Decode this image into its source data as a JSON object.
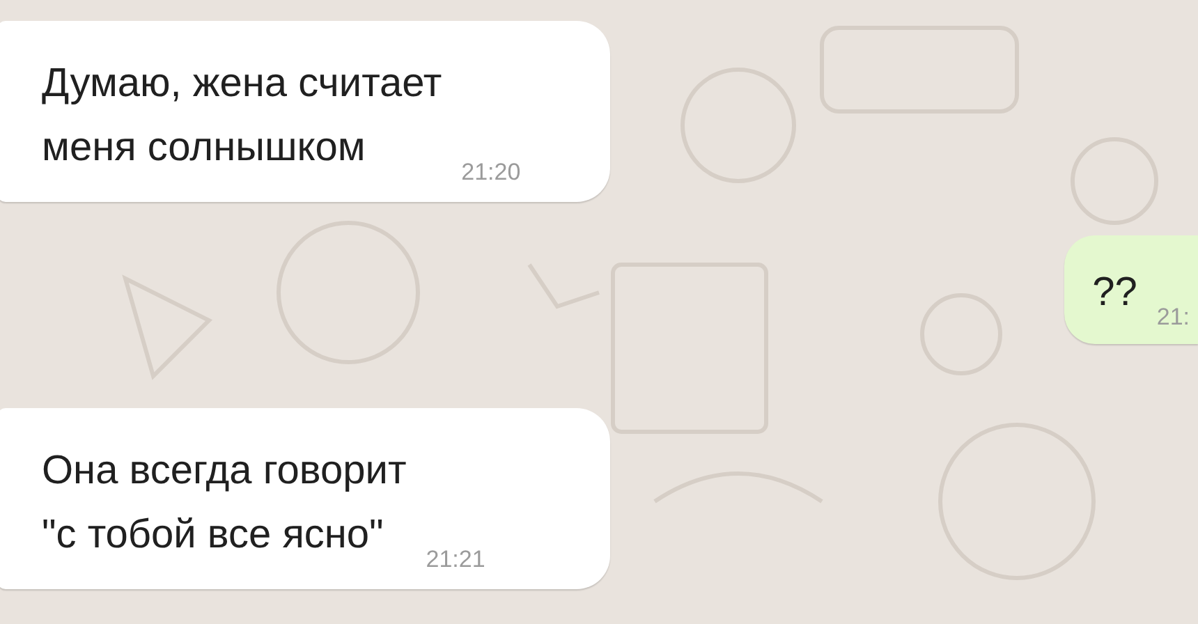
{
  "messages": [
    {
      "kind": "incoming",
      "text": "Думаю, жена считает\nменя солнышком",
      "time": "21:20"
    },
    {
      "kind": "outgoing",
      "text": "??",
      "time": "21:"
    },
    {
      "kind": "incoming",
      "text": "Она всегда говорит\n\"с тобой все ясно\"",
      "time": "21:21"
    }
  ]
}
